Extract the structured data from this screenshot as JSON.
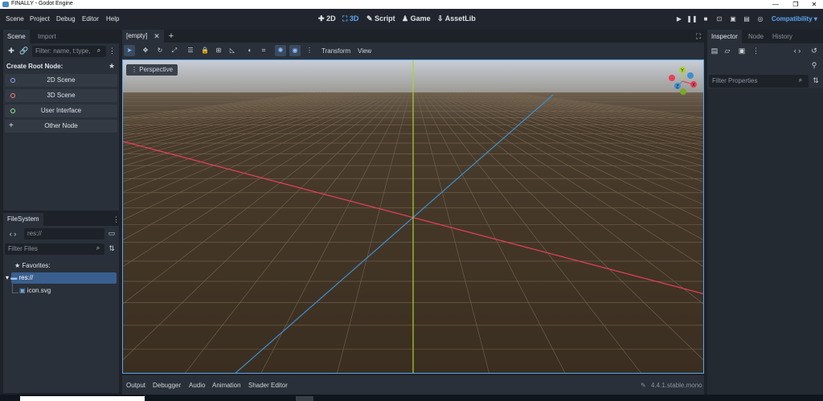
{
  "window": {
    "title": "FINALLY - Godot Engine",
    "minimize": "—",
    "maximize": "❐",
    "close": "✕"
  },
  "menu": [
    "Scene",
    "Project",
    "Debug",
    "Editor",
    "Help"
  ],
  "workspaces": {
    "w2d": "2D",
    "w3d": "3D",
    "script": "Script",
    "game": "Game",
    "assetlib": "AssetLib"
  },
  "renderer": "Compatibility",
  "scene_dock": {
    "tabs": [
      "Scene",
      "Import"
    ],
    "filter_placeholder": "Filter: name, t:type,",
    "create_root_label": "Create Root Node:",
    "root_buttons": [
      {
        "label": "2D Scene",
        "color": "#8da5f3"
      },
      {
        "label": "3D Scene",
        "color": "#fc7f7f"
      },
      {
        "label": "User Interface",
        "color": "#8eef97"
      },
      {
        "label": "Other Node",
        "color": "#e0e0e0"
      }
    ]
  },
  "filesystem": {
    "tab": "FileSystem",
    "path": "res://",
    "filter_placeholder": "Filter Files",
    "favorites": "Favorites:",
    "root": "res://",
    "files": [
      "icon.svg"
    ]
  },
  "editor": {
    "scene_tab": "[empty]",
    "transform_menu": "Transform",
    "view_menu": "View",
    "perspective": "Perspective"
  },
  "gizmo": {
    "y": "Y",
    "x": "X",
    "z": "Z"
  },
  "bottom_tabs": [
    "Output",
    "Debugger",
    "Audio",
    "Animation",
    "Shader Editor"
  ],
  "version": "4.4.1.stable.mono",
  "inspector": {
    "tabs": [
      "Inspector",
      "Node",
      "History"
    ],
    "filter_placeholder": "Filter Properties"
  },
  "colors": {
    "accent": "#5aa6f0",
    "x_axis": "#e8405a",
    "z_axis": "#3d8fd0",
    "y_axis": "#a9d431"
  }
}
